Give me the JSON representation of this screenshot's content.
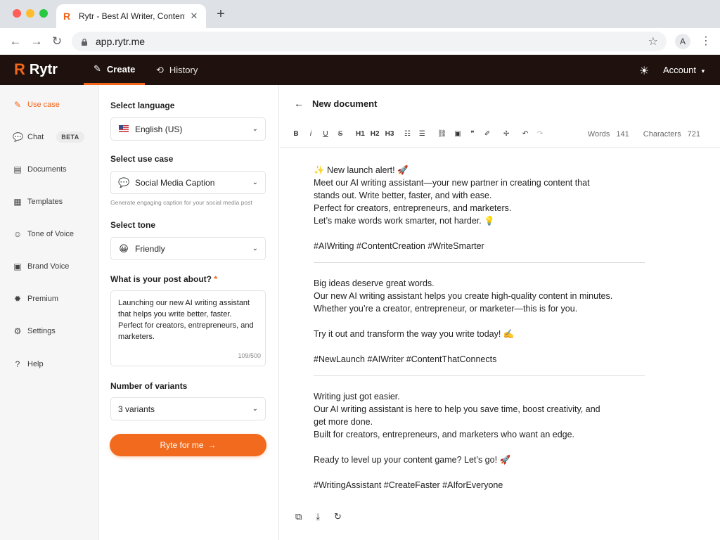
{
  "browser": {
    "tab_title": "Rytr - Best AI Writer, Content G",
    "url": "app.rytr.me",
    "profile_initial": "A"
  },
  "appbar": {
    "logo_text": "Rytr",
    "nav": [
      {
        "label": "Create",
        "icon": "pencil-icon",
        "active": true
      },
      {
        "label": "History",
        "icon": "history-icon",
        "active": false
      }
    ],
    "account_label": "Account"
  },
  "sidebar": {
    "items": [
      {
        "label": "Use case",
        "icon": "pen-icon",
        "active": true
      },
      {
        "label": "Chat",
        "icon": "chat-icon",
        "badge": "BETA"
      },
      {
        "label": "Documents",
        "icon": "document-icon"
      },
      {
        "label": "Templates",
        "icon": "templates-icon"
      },
      {
        "label": "Tone of Voice",
        "icon": "tone-icon"
      },
      {
        "label": "Brand Voice",
        "icon": "brand-icon"
      },
      {
        "label": "Premium",
        "icon": "premium-icon"
      },
      {
        "label": "Settings",
        "icon": "gear-icon"
      },
      {
        "label": "Help",
        "icon": "help-icon"
      }
    ]
  },
  "form": {
    "language_label": "Select language",
    "language_value": "English (US)",
    "usecase_label": "Select use case",
    "usecase_value": "Social Media Caption",
    "usecase_hint": "Generate engaging caption for your social media post",
    "tone_label": "Select tone",
    "tone_value": "Friendly",
    "about_label": "What is your post about?",
    "about_required": "*",
    "about_text": "Launching our new AI writing assistant that helps you write better, faster. Perfect for creators, entrepreneurs, and marketers.",
    "about_counter": "109/500",
    "variants_label": "Number of variants",
    "variants_value": "3 variants",
    "submit_label": "Ryte for me"
  },
  "editor": {
    "title": "New document",
    "toolbar": {
      "bold": "B",
      "italic": "i",
      "underline": "U",
      "strike": "S",
      "h1": "H1",
      "h2": "H2",
      "h3": "H3"
    },
    "words_label": "Words",
    "words_value": "141",
    "chars_label": "Characters",
    "chars_value": "721",
    "variants": [
      {
        "lines": [
          "✨ New launch alert! 🚀",
          "Meet our AI writing assistant—your new partner in creating content that",
          "stands out. Write better, faster, and with ease.",
          "Perfect for creators, entrepreneurs, and marketers.",
          "Let’s make words work smarter, not harder. 💡"
        ],
        "hashtags": "#AIWriting #ContentCreation #WriteSmarter"
      },
      {
        "lines": [
          "Big ideas deserve great words.",
          "Our new AI writing assistant helps you create high-quality content in minutes.",
          "Whether you’re a creator, entrepreneur, or marketer—this is for you."
        ],
        "cta": "Try it out and transform the way you write today! ✍️",
        "hashtags": "#NewLaunch #AIWriter #ContentThatConnects"
      },
      {
        "lines": [
          "Writing just got easier.",
          "Our AI writing assistant is here to help you save time, boost creativity, and",
          "get more done.",
          "Built for creators, entrepreneurs, and marketers who want an edge."
        ],
        "cta": "Ready to level up your content game? Let’s go! 🚀",
        "hashtags": "#WritingAssistant #CreateFaster #AIforEveryone"
      }
    ]
  },
  "colors": {
    "accent": "#f2651a",
    "appbar_bg": "#1f120e",
    "sidebar_bg": "#f6f6f6"
  }
}
